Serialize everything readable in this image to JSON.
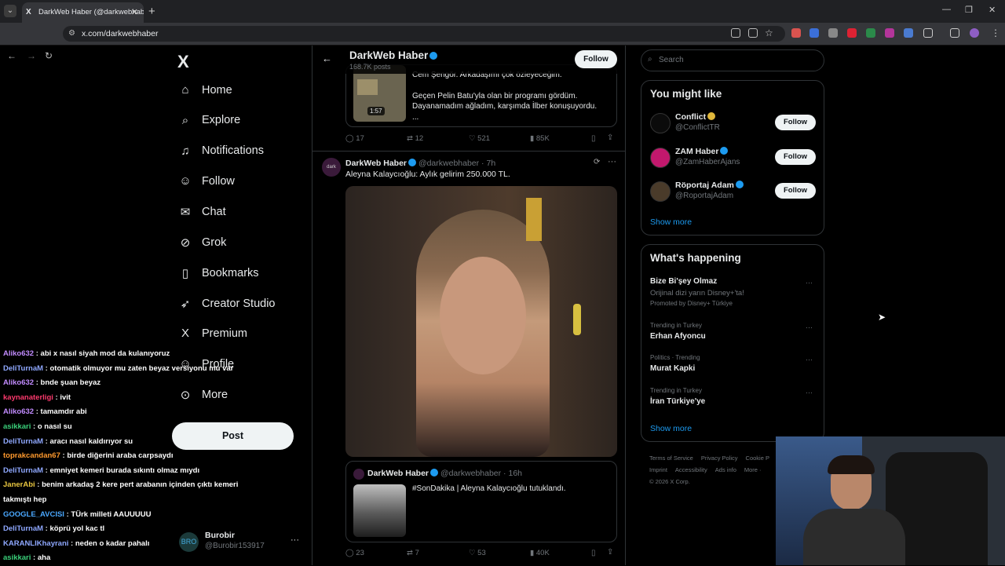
{
  "browser": {
    "tab_title": "DarkWeb Haber (@darkwebhaber)",
    "url": "x.com/darkwebhaber"
  },
  "nav": {
    "items": [
      {
        "label": "Home",
        "icon": "home-icon",
        "glyph": "⌂"
      },
      {
        "label": "Explore",
        "icon": "search-icon",
        "glyph": "⌕"
      },
      {
        "label": "Notifications",
        "icon": "bell-icon",
        "glyph": "♫"
      },
      {
        "label": "Follow",
        "icon": "person-add-icon",
        "glyph": "☺"
      },
      {
        "label": "Chat",
        "icon": "mail-icon",
        "glyph": "✉"
      },
      {
        "label": "Grok",
        "icon": "grok-icon",
        "glyph": "⊘"
      },
      {
        "label": "Bookmarks",
        "icon": "bookmark-icon",
        "glyph": "▯"
      },
      {
        "label": "Creator Studio",
        "icon": "rocket-icon",
        "glyph": "➶"
      },
      {
        "label": "Premium",
        "icon": "x-premium-icon",
        "glyph": "X"
      },
      {
        "label": "Profile",
        "icon": "profile-icon",
        "glyph": "☺"
      },
      {
        "label": "More",
        "icon": "more-circle-icon",
        "glyph": "⊙"
      }
    ],
    "post": "Post",
    "user_name": "Burobir",
    "user_handle": "@Burobir153917"
  },
  "header": {
    "name": "DarkWeb Haber",
    "posts": "168.7K posts",
    "follow": "Follow"
  },
  "tweet1": {
    "line0": "Cem Şengör. Arkadaşımı çok özleyeceğim.",
    "line1": "Geçen Pelin Batu'yla olan bir programı gördüm.",
    "line2": "Dayanamadım ağladım, karşımda İlber konuşuyordu.",
    "line3": "...",
    "duration": "1:57",
    "replies": "17",
    "retweets": "12",
    "likes": "521",
    "views": "85K"
  },
  "tweet2": {
    "name": "DarkWeb Haber",
    "handle": "@darkwebhaber",
    "time": "7h",
    "text": "Aleyna Kalaycıoğlu: Aylık gelirim 250.000 TL.",
    "quote": {
      "name": "DarkWeb Haber",
      "handle": "@darkwebhaber",
      "time": "16h",
      "text": "#SonDakika | Aleyna Kalaycıoğlu tutuklandı."
    },
    "replies": "23",
    "retweets": "7",
    "likes": "53",
    "views": "40K"
  },
  "search": {
    "placeholder": "Search"
  },
  "might_like": {
    "title": "You might like",
    "users": [
      {
        "name": "Conflict",
        "handle": "@ConflictTR",
        "color": "#0b0b0b"
      },
      {
        "name": "ZAM Haber",
        "handle": "@ZamHaberAjans",
        "color": "#c2186d"
      },
      {
        "name": "Röportaj Adam",
        "handle": "@RoportajAdam",
        "color": "#4a3b2a"
      }
    ],
    "follow": "Follow",
    "show_more": "Show more"
  },
  "happening": {
    "title": "What's happening",
    "items": [
      {
        "context": "",
        "topic": "Bize Bi'şey Olmaz",
        "sub": "Orijinal dizi yarın Disney+'ta!",
        "promo": "Promoted by Disney+ Türkiye"
      },
      {
        "context": "Trending in Turkey",
        "topic": "Erhan Afyoncu"
      },
      {
        "context": "Politics · Trending",
        "topic": "Murat Kapki"
      },
      {
        "context": "Trending in Turkey",
        "topic": "İran Türkiye'ye"
      }
    ],
    "show_more": "Show more"
  },
  "footer": {
    "links": [
      "Terms of Service",
      "Privacy Policy",
      "Cookie P",
      "Imprint",
      "Accessibility",
      "Ads info",
      "More ·"
    ],
    "copyright": "© 2026 X Corp."
  },
  "chat": [
    {
      "user": "Aliko632",
      "msg": "abi x nasıl siyah mod da kulanıyoruz",
      "color": "#c28cff"
    },
    {
      "user": "DeliTurnaM",
      "msg": "otomatik olmuyor mu zaten beyaz versiyonu mu var",
      "color": "#8fa8ff"
    },
    {
      "user": "Aliko632",
      "msg": "bnde şuan beyaz",
      "color": "#c28cff"
    },
    {
      "user": "kaynanaterligi",
      "msg": "ivit",
      "color": "#ff3a6e"
    },
    {
      "user": "Aliko632",
      "msg": "tamamdır abi",
      "color": "#c28cff"
    },
    {
      "user": "asikkari",
      "msg": "o nasıl su",
      "color": "#3ad07a"
    },
    {
      "user": "DeliTurnaM",
      "msg": "aracı nasıl kaldırıyor su",
      "color": "#8fa8ff"
    },
    {
      "user": "toprakcandan67",
      "msg": "birde diğerini araba carpsaydı",
      "color": "#ff9a2e"
    },
    {
      "user": "DeliTurnaM",
      "msg": "emniyet kemeri burada sıkıntı olmaz mıydı",
      "color": "#8fa8ff"
    },
    {
      "user": "JanerAbi",
      "msg": "benim arkadaş 2 kere pert arabanın içinden çıktı kemeri",
      "color": "#e8c640"
    },
    {
      "user": "",
      "msg": "takmıştı hep",
      "color": "#fff"
    },
    {
      "user": "GOOGLE_AVCISI",
      "msg": "TÜrk milleti AAUUUUU",
      "color": "#4aa8ff"
    },
    {
      "user": "DeliTurnaM",
      "msg": "köprü yol kac tl",
      "color": "#8fa8ff"
    },
    {
      "user": "KARANLIKhayrani",
      "msg": "neden o kadar pahalı",
      "color": "#8fa8ff"
    },
    {
      "user": "asikkari",
      "msg": "aha",
      "color": "#3ad07a"
    }
  ]
}
